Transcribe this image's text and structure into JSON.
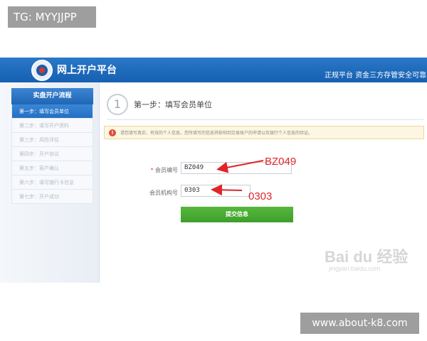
{
  "watermarks": {
    "top_left": "TG: MYYJJPP",
    "bottom_right": "www.about-k8.com",
    "baidu": "Bai du 经验",
    "baidu_sub": "jingyan.baidu.com"
  },
  "header": {
    "title": "网上开户平台",
    "slogan": "正规平台 资金三方存管安全可靠"
  },
  "sidebar": {
    "heading": "实盘开户流程",
    "items": [
      {
        "label": "第一步：填写会员单位"
      },
      {
        "label": "第二步：填写开户资料"
      },
      {
        "label": "第三步：风险评估"
      },
      {
        "label": "第四步：开户协议"
      },
      {
        "label": "第五步：客户确认"
      },
      {
        "label": "第六步：填写银行卡信息"
      },
      {
        "label": "第七步：开户成功"
      }
    ]
  },
  "step": {
    "number": "1",
    "title": "第一步：填写会员单位"
  },
  "notice": {
    "icon": "!",
    "text": "请您填写真实、有效的个人信息，您所填写的信息将影响到交易账户的申请以及银行个人信息的验证。"
  },
  "form": {
    "member_code": {
      "required_mark": "*",
      "label": "会员编号",
      "value": "BZ049"
    },
    "member_org_code": {
      "label": "会员机构号",
      "value": "0303"
    },
    "submit_label": "提交信息"
  },
  "annotations": {
    "member_code": "BZ049",
    "member_org_code": "0303"
  },
  "colors": {
    "header_blue": "#1b66b8",
    "submit_green": "#4caf34",
    "annotation_red": "#e0242a"
  }
}
